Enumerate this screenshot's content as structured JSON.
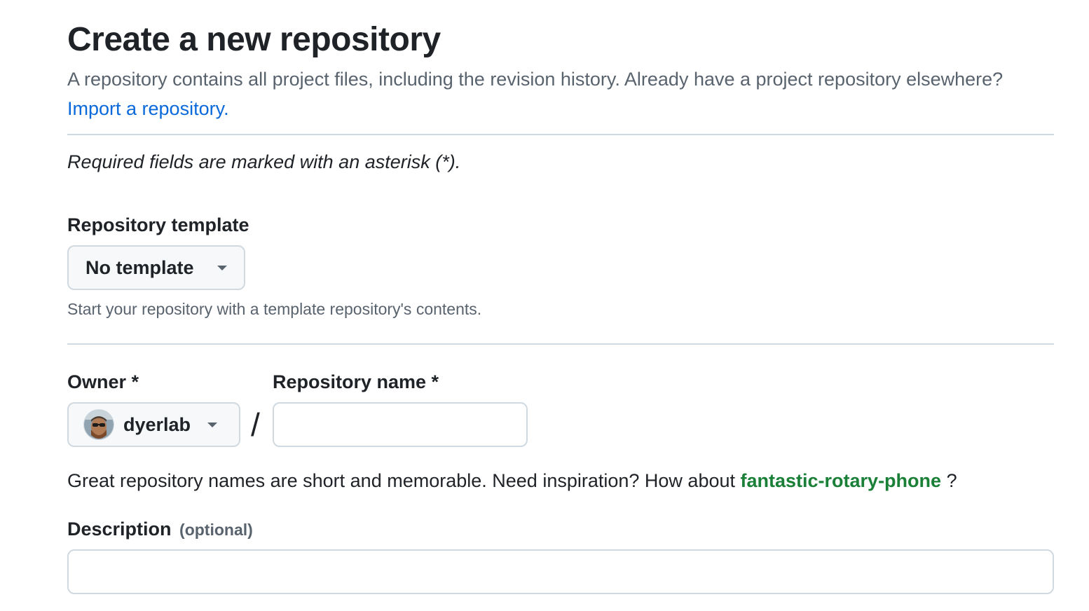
{
  "header": {
    "title": "Create a new repository",
    "subtitle": "A repository contains all project files, including the revision history. Already have a project repository elsewhere?",
    "import_link": "Import a repository."
  },
  "form": {
    "required_note": "Required fields are marked with an asterisk (*).",
    "template": {
      "label": "Repository template",
      "selected": "No template",
      "hint": "Start your repository with a template repository's contents."
    },
    "owner": {
      "label": "Owner *",
      "selected": "dyerlab"
    },
    "separator": "/",
    "repo_name": {
      "label": "Repository name *",
      "value": "",
      "hint_prefix": "Great repository names are short and memorable. Need inspiration? How about",
      "suggestion": "fantastic-rotary-phone",
      "hint_suffix": "?"
    },
    "description": {
      "label": "Description",
      "optional": "(optional)",
      "value": ""
    }
  },
  "colors": {
    "link": "#0969da",
    "suggestion": "#1a7f37",
    "muted": "#59636e",
    "border": "#d1d9e0",
    "button_bg": "#f6f8fa"
  }
}
